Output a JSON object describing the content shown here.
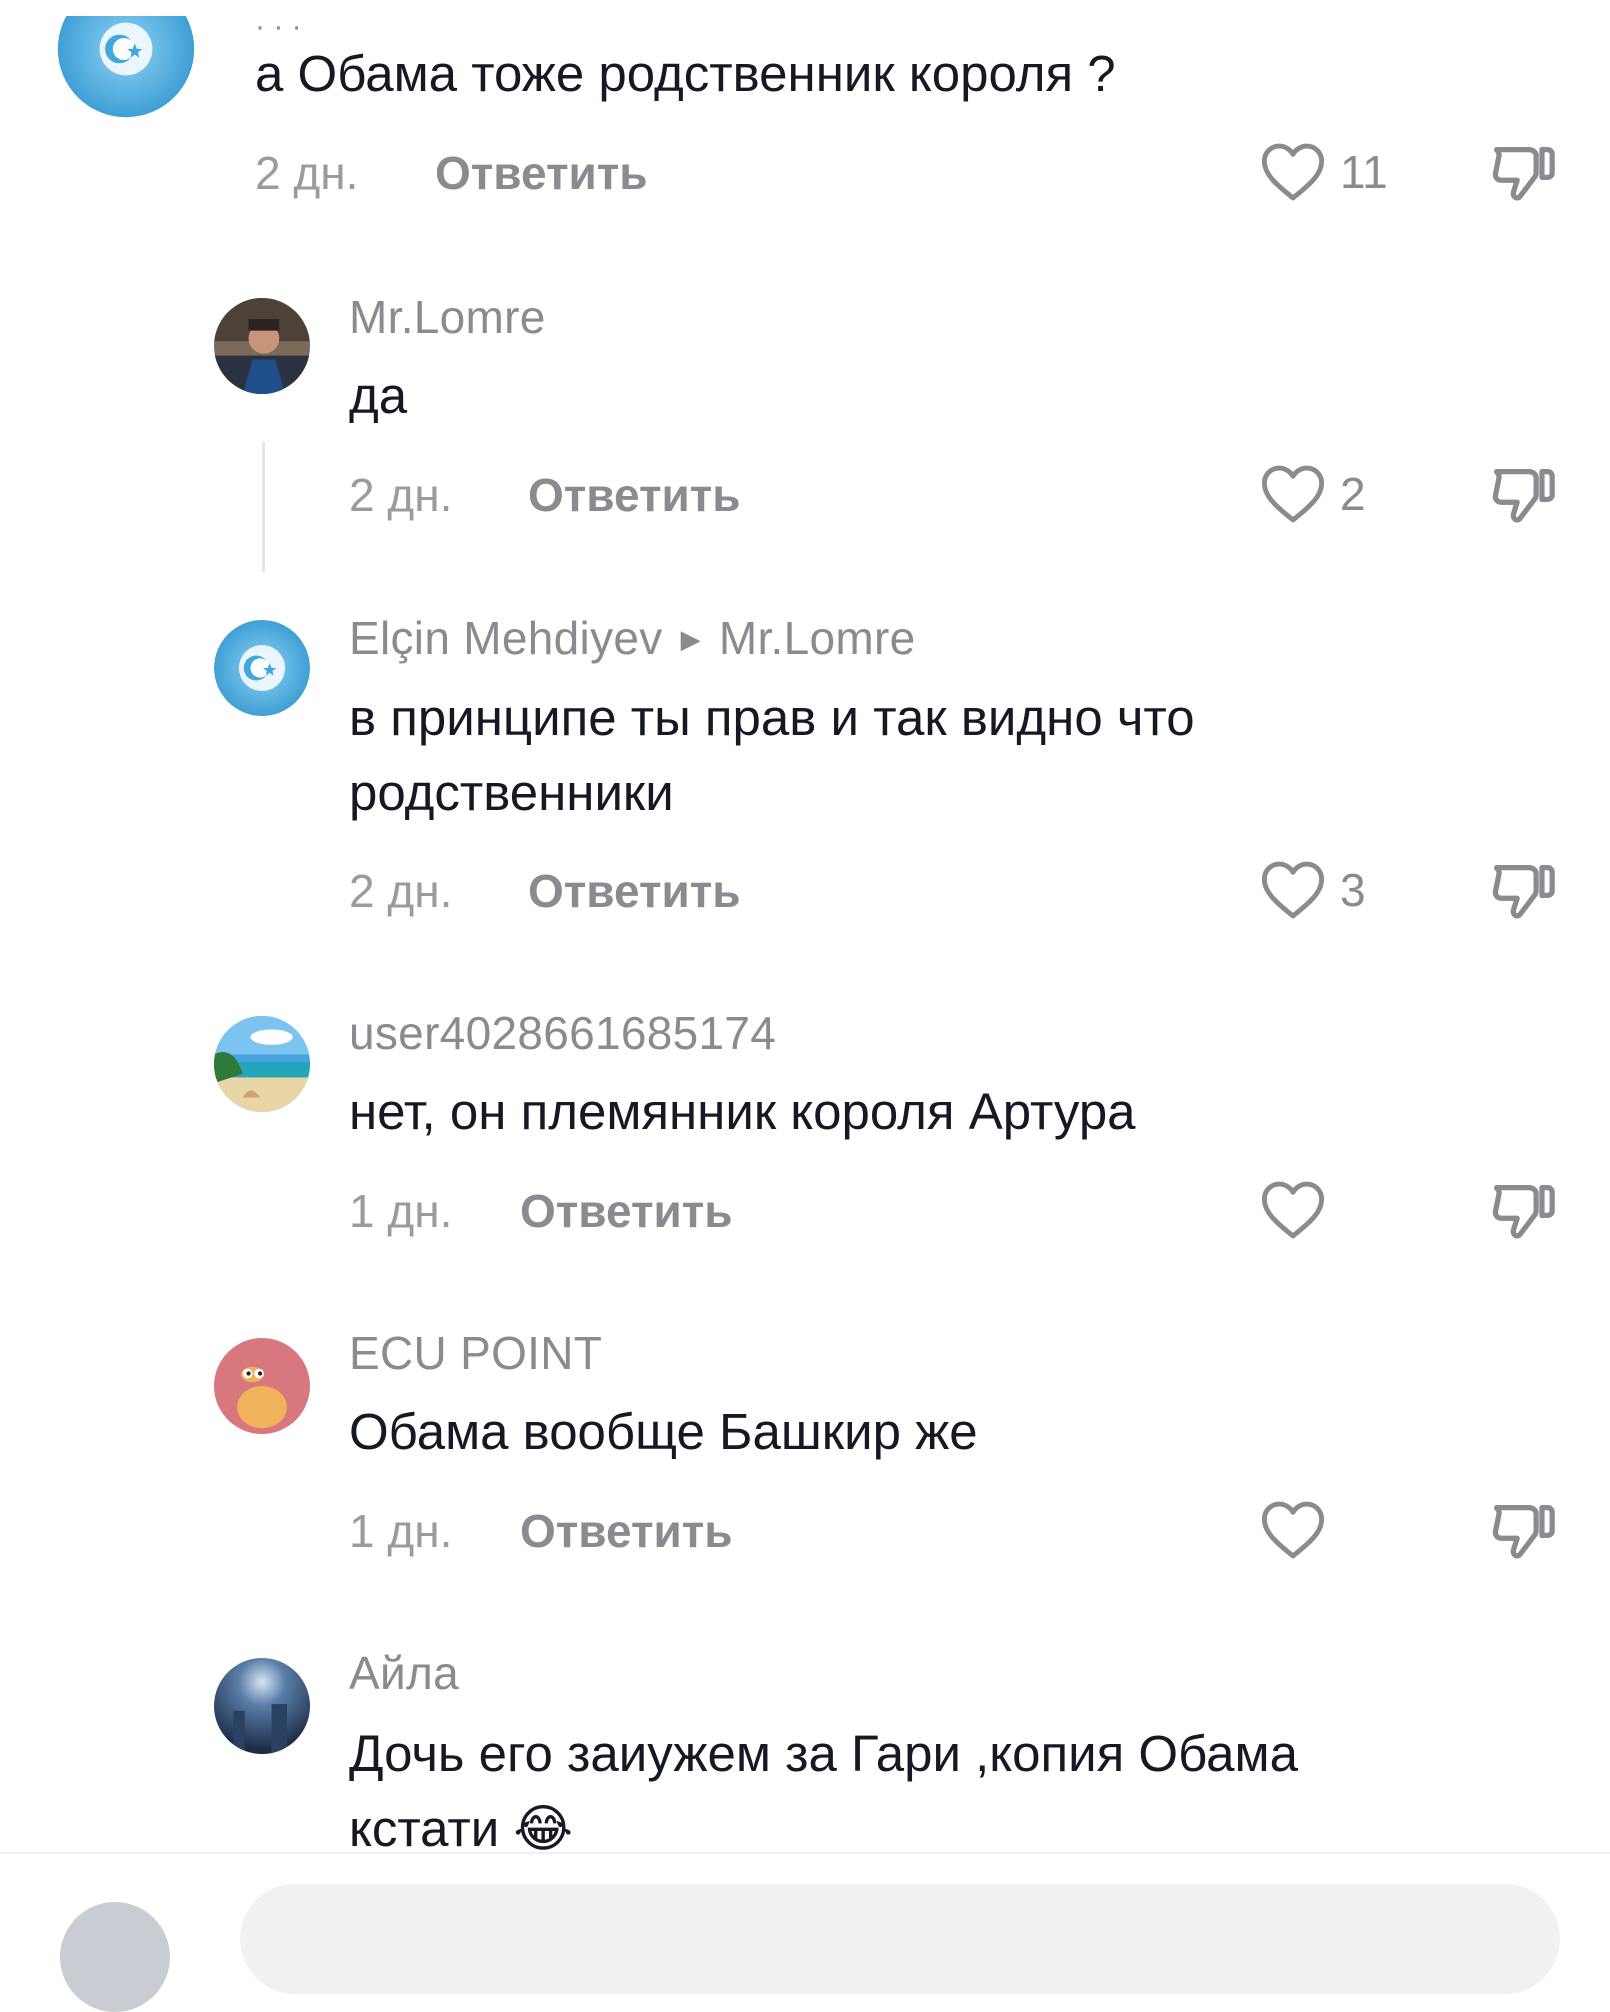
{
  "comments": [
    {
      "username": "",
      "text": "а Обама тоже родственник короля ?",
      "time": "2 дн.",
      "reply_label": "Ответить",
      "likes": "11"
    },
    {
      "username": "Mr.Lomre",
      "text": "да",
      "time": "2 дн.",
      "reply_label": "Ответить",
      "likes": "2"
    },
    {
      "username": "Elçin Mehdiyev",
      "reply_to": "Mr.Lomre",
      "text": "в принципе ты прав и так видно что родственники",
      "time": "2 дн.",
      "reply_label": "Ответить",
      "likes": "3"
    },
    {
      "username": "user4028661685174",
      "text": "нет, он племянник короля Артура",
      "time": "1 дн.",
      "reply_label": "Ответить",
      "likes": ""
    },
    {
      "username": "ECU POINT",
      "text": "Обама вообще Башкир же",
      "time": "1 дн.",
      "reply_label": "Ответить",
      "likes": ""
    },
    {
      "username": "Айла",
      "text": "Дочь его заиужем за Гари ,копия Обама кстати 😂",
      "time": "",
      "reply_label": "",
      "likes": ""
    }
  ],
  "icons": {
    "like": "heart-outline-icon",
    "dislike": "thumbs-down-outline-icon",
    "reply_arrow": "play-triangle-icon"
  },
  "colors": {
    "text": "#161823",
    "muted": "#8a8b91",
    "flag_blue": "#3fa8dd"
  }
}
